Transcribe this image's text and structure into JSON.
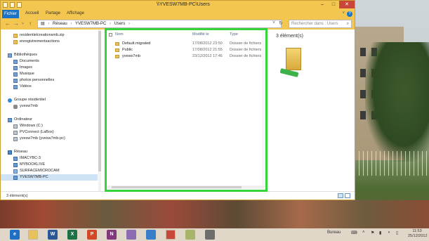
{
  "window": {
    "title": "\\\\YVESW7MB-PC\\Users",
    "controls": {
      "minimize": "–",
      "maximize": "□",
      "close": "✕"
    }
  },
  "ribbon": {
    "tabs": [
      "Fichier",
      "Accueil",
      "Partage",
      "Affichage"
    ],
    "help": "?"
  },
  "address": {
    "back": "←",
    "forward": "→",
    "up": "↑",
    "crumbs": [
      "Réseau",
      "YVESW7MB-PC",
      "Users"
    ],
    "refresh": "↻",
    "search_placeholder": "Rechercher dans : Users"
  },
  "nav": {
    "items": [
      {
        "label": "residentielcreationsmb.zip",
        "icon": "folder-icon",
        "indent": 1
      },
      {
        "label": "enregistrementsactions",
        "icon": "folder-icon",
        "indent": 1
      },
      {
        "label": "Bibliothèques",
        "icon": "library-icon",
        "indent": 0
      },
      {
        "label": "Documents",
        "icon": "library-icon",
        "indent": 1
      },
      {
        "label": "Images",
        "icon": "library-icon",
        "indent": 1
      },
      {
        "label": "Musique",
        "icon": "library-icon",
        "indent": 1
      },
      {
        "label": "photos personnelles",
        "icon": "library-icon",
        "indent": 1
      },
      {
        "label": "Vidéos",
        "icon": "library-icon",
        "indent": 1
      },
      {
        "label": "Groupe résidentiel",
        "icon": "homegroup-icon",
        "indent": 0
      },
      {
        "label": "yvesw7mb",
        "icon": "user-icon",
        "indent": 1
      },
      {
        "label": "Ordinateur",
        "icon": "computer-icon",
        "indent": 0
      },
      {
        "label": "Windows (C:)",
        "icon": "drive-icon",
        "indent": 1
      },
      {
        "label": "PVConnect (LaBox)",
        "icon": "drive-icon",
        "indent": 1
      },
      {
        "label": "yvesw7mb (yvesw7mb-pc)",
        "icon": "drive-icon",
        "indent": 1
      },
      {
        "label": "Réseau",
        "icon": "network-icon",
        "indent": 0
      },
      {
        "label": "IMACYBC-3",
        "icon": "computer-icon",
        "indent": 1
      },
      {
        "label": "MYBOOKLIVE",
        "icon": "computer-icon",
        "indent": 1
      },
      {
        "label": "SURFACEMICROCAM",
        "icon": "media-icon",
        "indent": 1
      },
      {
        "label": "YVESW7MB-PC",
        "icon": "computer-icon",
        "indent": 1
      }
    ]
  },
  "filelist": {
    "columns": {
      "name": "Nom",
      "modified": "Modifié le",
      "type": "Type"
    },
    "rows": [
      {
        "name": "Default.migrated",
        "modified": "17/08/2012 23:50",
        "type": "Dossier de fichiers"
      },
      {
        "name": "Public",
        "modified": "17/08/2012 21:55",
        "type": "Dossier de fichiers"
      },
      {
        "name": "yvesw7mb",
        "modified": "23/12/2012 17:46",
        "type": "Dossier de fichiers"
      }
    ]
  },
  "preview": {
    "count": "3 élément(s)"
  },
  "status": {
    "text": "3 élément(s)"
  },
  "taskbar": {
    "apps": [
      "e",
      "",
      "W",
      "X",
      "P",
      "N",
      "",
      "",
      "",
      "",
      ""
    ],
    "desktop_label": "Bureau",
    "clock_time": "11:53",
    "clock_date": "25/12/2012"
  },
  "colors": {
    "window_frame": "#f2c64f",
    "file_tab": "#1a73c6",
    "highlight": "#35d43a",
    "close": "#c9473a"
  }
}
